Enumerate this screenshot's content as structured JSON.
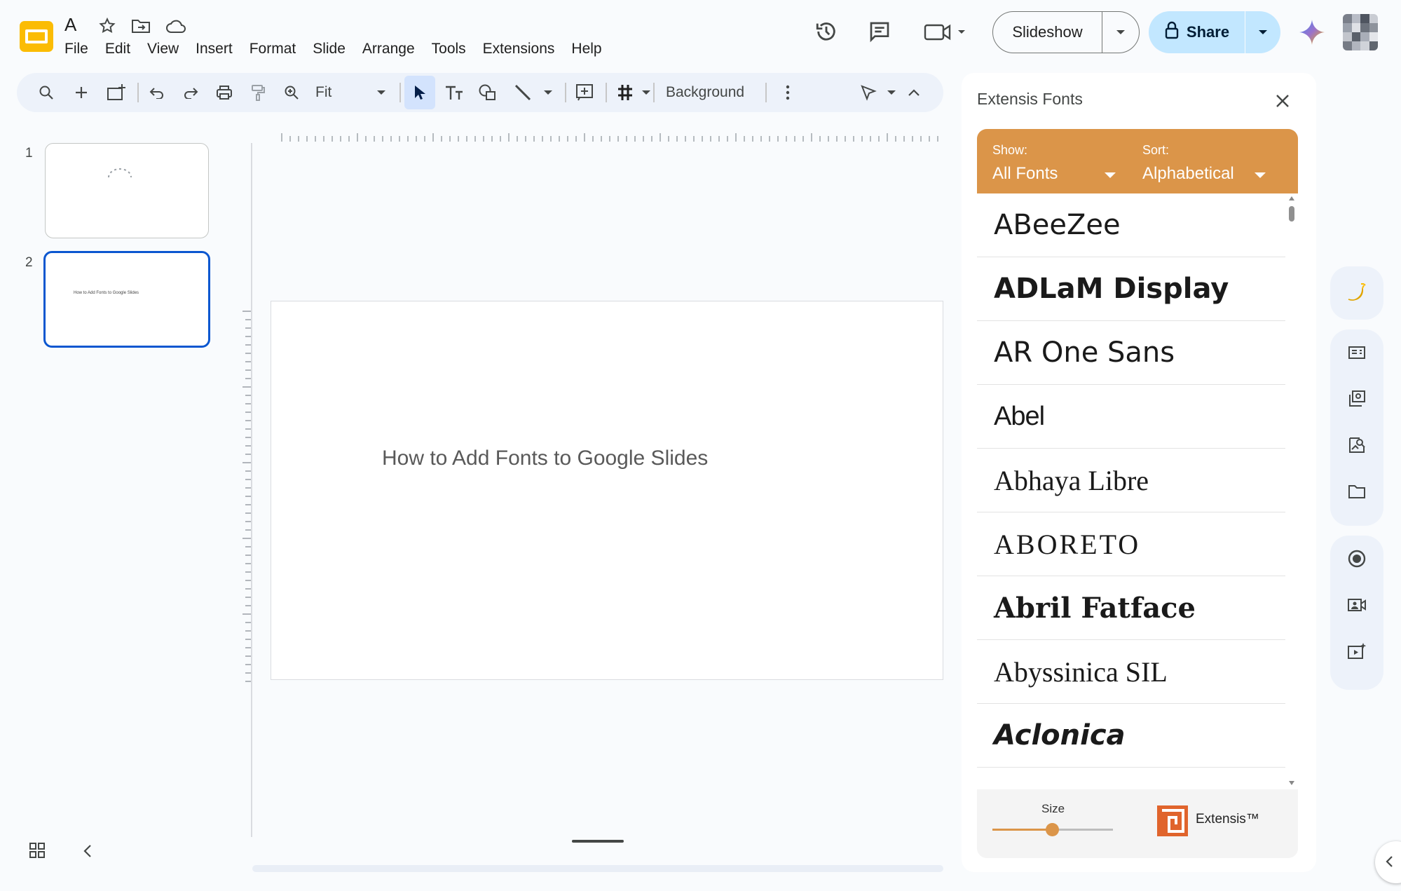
{
  "doc": {
    "title": "A"
  },
  "menu": [
    "File",
    "Edit",
    "View",
    "Insert",
    "Format",
    "Slide",
    "Arrange",
    "Tools",
    "Extensions",
    "Help"
  ],
  "header": {
    "slideshow_label": "Slideshow",
    "share_label": "Share"
  },
  "toolbar": {
    "zoom_label": "Fit",
    "background_label": "Background"
  },
  "filmstrip": {
    "slides": [
      {
        "number": "1",
        "text": ""
      },
      {
        "number": "2",
        "text": "How to Add Fonts to Google Slides"
      }
    ]
  },
  "slide": {
    "title": "How to Add Fonts to Google Slides"
  },
  "panel": {
    "title": "Extensis Fonts",
    "show_label": "Show:",
    "show_value": "All Fonts",
    "sort_label": "Sort:",
    "sort_value": "Alphabetical",
    "fonts": [
      "ABeeZee",
      "ADLaM Display",
      "AR One Sans",
      "Abel",
      "Abhaya Libre",
      "ABORETO",
      "Abril Fatface",
      "Abyssinica SIL",
      "Aclonica"
    ],
    "size_label": "Size",
    "size_value": 0.5,
    "brand": "Extensis™"
  },
  "colors": {
    "accent": "#0b57d0",
    "panel_orange": "#db9549",
    "share_bg": "#c2e7ff"
  }
}
